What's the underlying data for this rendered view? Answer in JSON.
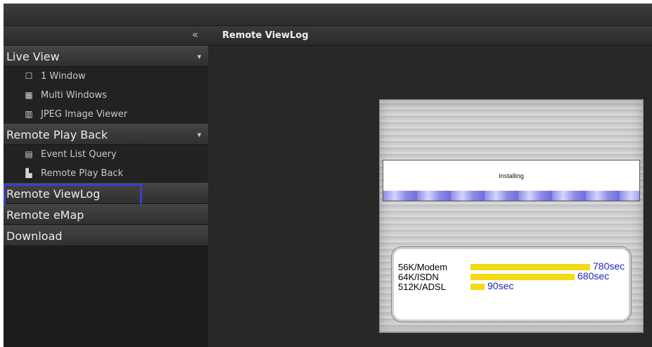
{
  "sidebar": {
    "collapse_glyph": "«",
    "groups": [
      {
        "label": "Live View",
        "items": [
          {
            "label": "1 Window",
            "icon": "window-icon"
          },
          {
            "label": "Multi Windows",
            "icon": "grid-icon"
          },
          {
            "label": "JPEG Image Viewer",
            "icon": "film-icon"
          }
        ]
      },
      {
        "label": "Remote Play Back",
        "items": [
          {
            "label": "Event List Query",
            "icon": "document-icon"
          },
          {
            "label": "Remote Play Back",
            "icon": "playback-icon"
          }
        ]
      },
      {
        "label": "Remote ViewLog"
      },
      {
        "label": "Remote eMap"
      },
      {
        "label": "Download"
      }
    ]
  },
  "main": {
    "title": "Remote ViewLog",
    "install_status": "Installing",
    "speeds": [
      {
        "label": "56K/Modem",
        "time": "780sec",
        "seconds": 780
      },
      {
        "label": "64K/ISDN",
        "time": "680sec",
        "seconds": 680
      },
      {
        "label": "512K/ADSL",
        "time": "90sec",
        "seconds": 90
      }
    ]
  },
  "colors": {
    "selection_border": "#3b40c9",
    "speed_bar": "#f4d916",
    "speed_time": "#2424b8"
  }
}
